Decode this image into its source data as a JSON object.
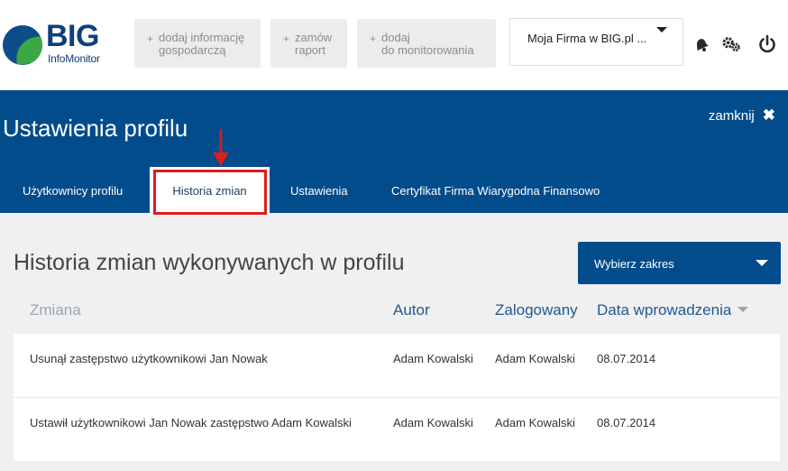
{
  "logo": {
    "brand": "BIG",
    "sub": "InfoMonitor"
  },
  "topbar": {
    "buttons": [
      {
        "plus": "+",
        "label": "dodaj informację\ngospodarczą"
      },
      {
        "plus": "+",
        "label": "zamów\nraport"
      },
      {
        "plus": "+",
        "label": "dodaj\ndo monitorowania"
      }
    ],
    "company_select": "Moja Firma w BIG.pl ...",
    "icons": [
      "bell-icon",
      "gear-icon",
      "power-icon"
    ]
  },
  "band": {
    "title": "Ustawienia profilu",
    "close_label": "zamknij",
    "close_glyph": "✖",
    "tabs": [
      "Użytkownicy profilu",
      "Historia zmian",
      "Ustawienia",
      "Certyfikat Firma Wiarygodna Finansowo"
    ]
  },
  "content": {
    "title": "Historia zmian wykonywanych w profilu",
    "range_button": "Wybierz zakres",
    "columns": [
      "Zmiana",
      "Autor",
      "Zalogowany",
      "Data wprowadzenia"
    ],
    "rows": [
      [
        "Usunął zastępstwo użytkownikowi Jan Nowak",
        "Adam Kowalski",
        "Adam Kowalski",
        "08.07.2014"
      ],
      [
        "Ustawił użytkownikowi Jan Nowak zastępstwo Adam Kowalski",
        "Adam Kowalski",
        "Adam Kowalski",
        "08.07.2014"
      ]
    ]
  },
  "colors": {
    "brand_blue": "#034c8c",
    "logo_green": "#3aa843",
    "highlight_red": "#e01b1b"
  }
}
